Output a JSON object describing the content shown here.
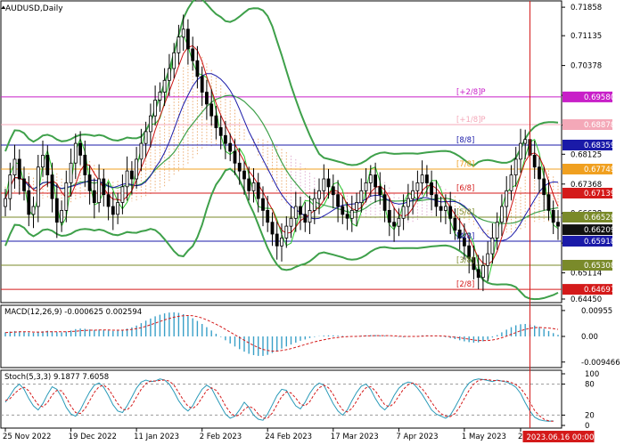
{
  "instrument": {
    "title": "AUDUSD,Daily"
  },
  "chart_data": [
    {
      "type": "candlestick",
      "title": "AUDUSD,Daily",
      "ylim": [
        0.6445,
        0.7195
      ],
      "y_ticks": [
        "0.71858",
        "0.71135",
        "0.70378",
        "0.69621",
        "0.68864",
        "0.68125",
        "0.67368",
        "0.66628",
        "0.65871",
        "0.65114",
        "0.64450"
      ],
      "x_ticks": [
        "25 Nov 2022",
        "19 Dec 2022",
        "11 Jan 2023",
        "2 Feb 2023",
        "24 Feb 2023",
        "17 Mar 2023",
        "7 Apr 2023",
        "1 May 2023",
        "23 May 2023"
      ],
      "crosshair_label": "2023.06.16 00:00",
      "close": [
        0.67,
        0.676,
        0.68,
        0.675,
        0.672,
        0.666,
        0.668,
        0.678,
        0.681,
        0.676,
        0.67,
        0.664,
        0.667,
        0.674,
        0.679,
        0.684,
        0.681,
        0.676,
        0.672,
        0.669,
        0.675,
        0.671,
        0.668,
        0.666,
        0.669,
        0.673,
        0.677,
        0.675,
        0.68,
        0.684,
        0.687,
        0.691,
        0.695,
        0.697,
        0.7,
        0.703,
        0.707,
        0.711,
        0.713,
        0.708,
        0.705,
        0.701,
        0.697,
        0.694,
        0.691,
        0.688,
        0.686,
        0.684,
        0.682,
        0.679,
        0.677,
        0.675,
        0.672,
        0.674,
        0.67,
        0.667,
        0.664,
        0.661,
        0.658,
        0.66,
        0.663,
        0.665,
        0.668,
        0.666,
        0.664,
        0.667,
        0.67,
        0.672,
        0.675,
        0.673,
        0.671,
        0.668,
        0.666,
        0.665,
        0.667,
        0.669,
        0.672,
        0.674,
        0.676,
        0.673,
        0.671,
        0.667,
        0.664,
        0.663,
        0.665,
        0.668,
        0.67,
        0.672,
        0.674,
        0.676,
        0.674,
        0.671,
        0.668,
        0.667,
        0.668,
        0.665,
        0.662,
        0.66,
        0.658,
        0.655,
        0.652,
        0.65,
        0.653,
        0.656,
        0.66,
        0.664,
        0.668,
        0.672,
        0.676,
        0.68,
        0.684,
        0.685,
        0.681,
        0.678,
        0.675,
        0.671,
        0.667,
        0.664,
        0.663
      ],
      "series": [
        {
          "name": "",
          "kind": "bollinger-upper",
          "color": "#3ea04a"
        },
        {
          "name": "",
          "kind": "bollinger-lower",
          "color": "#3ea04a"
        },
        {
          "name": "",
          "kind": "envelope",
          "color": "#27c92a"
        },
        {
          "name": "",
          "kind": "tenkan",
          "color": "#cc1111"
        },
        {
          "name": "",
          "kind": "kijun",
          "color": "#1a1aa8"
        },
        {
          "name": "",
          "kind": "ichimoku-cloud",
          "color": "#e8a05c"
        }
      ],
      "levels": [
        {
          "label": "[+2/8]P",
          "value": "0.69580",
          "color": "#c81fc8"
        },
        {
          "label": "[+1/8]P",
          "value": "0.68878",
          "color": "#f4a8b8"
        },
        {
          "label": "[8/8]",
          "value": "0.68359",
          "color": "#1a1aa8"
        },
        {
          "label": "[7/8]",
          "value": "0.67749",
          "color": "#f0a020"
        },
        {
          "label": "[6/8]",
          "value": "0.67139",
          "color": "#d41a1a"
        },
        {
          "label": "[5/8]",
          "value": "0.66528",
          "color": "#7a8a2a"
        },
        {
          "label": "[4/8]",
          "value": "0.65918",
          "color": "#1a1aa8"
        },
        {
          "label": "[3/8]",
          "value": "0.65308",
          "color": "#7a8a2a"
        },
        {
          "label": "[2/8]",
          "value": "0.64697",
          "color": "#d41a1a"
        }
      ],
      "current_price": "0.66209",
      "current_price_color": "#111111"
    },
    {
      "type": "histogram",
      "title": "MACD(12,26,9) -0.000625 0.002594",
      "ylim": [
        -0.0105,
        0.0105
      ],
      "y_ticks": [
        "0.00955",
        "0.00",
        "-0.009466"
      ],
      "macd": [
        0.0015,
        0.0018,
        0.002,
        0.0019,
        0.0017,
        0.0014,
        0.0013,
        0.0016,
        0.0019,
        0.0021,
        0.0019,
        0.0016,
        0.0015,
        0.0018,
        0.0022,
        0.0027,
        0.0029,
        0.0028,
        0.0026,
        0.0024,
        0.0025,
        0.0024,
        0.0022,
        0.002,
        0.0021,
        0.0024,
        0.0029,
        0.0033,
        0.004,
        0.0049,
        0.0058,
        0.0066,
        0.0074,
        0.008,
        0.0085,
        0.0088,
        0.0089,
        0.0087,
        0.0082,
        0.0075,
        0.0067,
        0.0057,
        0.0046,
        0.0034,
        0.0022,
        0.001,
        -0.0002,
        -0.0014,
        -0.0026,
        -0.0037,
        -0.0047,
        -0.0056,
        -0.0064,
        -0.0069,
        -0.0072,
        -0.0072,
        -0.0068,
        -0.0061,
        -0.0053,
        -0.0045,
        -0.0037,
        -0.003,
        -0.0023,
        -0.0016,
        -0.0011,
        -0.0006,
        -0.0002,
        0.0001,
        0.0003,
        0.0004,
        0.0004,
        0.0003,
        0.0002,
        0.0001,
        0.0001,
        0.0002,
        0.0003,
        0.0004,
        0.0005,
        0.0005,
        0.0004,
        0.0003,
        0.0001,
        -0.0001,
        -0.0002,
        -0.0003,
        -0.0002,
        0.0,
        0.0002,
        0.0004,
        0.0004,
        0.0003,
        0.0001,
        -0.0001,
        -0.0003,
        -0.0006,
        -0.001,
        -0.0014,
        -0.0018,
        -0.0021,
        -0.0023,
        -0.0022,
        -0.0018,
        -0.0012,
        -0.0004,
        0.0005,
        0.0015,
        0.0025,
        0.0034,
        0.0041,
        0.0045,
        0.0046,
        0.0044,
        0.004,
        0.0035,
        0.0028,
        0.002,
        0.0012,
        0.0006
      ],
      "signal": [
        0.0014,
        0.0015,
        0.0016,
        0.0017,
        0.0017,
        0.0017,
        0.0016,
        0.0016,
        0.0016,
        0.0017,
        0.0017,
        0.0017,
        0.0017,
        0.0017,
        0.0018,
        0.0019,
        0.0021,
        0.0022,
        0.0023,
        0.0023,
        0.0024,
        0.0024,
        0.0024,
        0.0023,
        0.0023,
        0.0023,
        0.0024,
        0.0026,
        0.0029,
        0.0032,
        0.0037,
        0.0043,
        0.0049,
        0.0055,
        0.0061,
        0.0066,
        0.0071,
        0.0074,
        0.0076,
        0.0077,
        0.0076,
        0.0073,
        0.0068,
        0.0061,
        0.0053,
        0.0045,
        0.0036,
        0.0026,
        0.0016,
        0.0006,
        -0.0004,
        -0.0014,
        -0.0024,
        -0.0033,
        -0.0041,
        -0.0048,
        -0.0052,
        -0.0054,
        -0.0054,
        -0.0052,
        -0.0049,
        -0.0045,
        -0.004,
        -0.0035,
        -0.003,
        -0.0025,
        -0.002,
        -0.0016,
        -0.0012,
        -0.0009,
        -0.0006,
        -0.0004,
        -0.0002,
        -0.0001,
        0.0,
        0.0,
        0.0001,
        0.0002,
        0.0002,
        0.0003,
        0.0003,
        0.0003,
        0.0003,
        0.0002,
        0.0001,
        0.0,
        0.0,
        0.0,
        0.0,
        0.0001,
        0.0002,
        0.0002,
        0.0002,
        0.0002,
        0.0001,
        -0.0001,
        -0.0003,
        -0.0005,
        -0.0008,
        -0.001,
        -0.0013,
        -0.0015,
        -0.0015,
        -0.0015,
        -0.0013,
        -0.001,
        -0.0005,
        0.0001,
        0.0008,
        0.0014,
        0.0021,
        0.0026,
        0.003,
        0.0032,
        0.0033,
        0.0032,
        0.0031,
        0.0029,
        0.0026
      ]
    },
    {
      "type": "line",
      "title": "Stoch(5,3,3) 9.1877 7.6058",
      "ylim": [
        0,
        100
      ],
      "y_ticks": [
        "100",
        "80",
        "20",
        "0"
      ],
      "main": [
        45,
        58,
        72,
        80,
        70,
        52,
        38,
        30,
        42,
        60,
        75,
        70,
        55,
        35,
        22,
        18,
        30,
        48,
        65,
        78,
        82,
        74,
        58,
        40,
        28,
        25,
        38,
        55,
        72,
        84,
        88,
        85,
        86,
        90,
        88,
        80,
        65,
        48,
        35,
        28,
        38,
        55,
        70,
        78,
        72,
        55,
        38,
        22,
        14,
        18,
        30,
        45,
        35,
        20,
        12,
        10,
        22,
        40,
        58,
        70,
        68,
        52,
        38,
        32,
        45,
        62,
        75,
        82,
        78,
        60,
        42,
        28,
        20,
        30,
        48,
        64,
        76,
        80,
        70,
        52,
        38,
        30,
        40,
        58,
        72,
        80,
        84,
        82,
        72,
        60,
        45,
        30,
        22,
        18,
        14,
        20,
        35,
        52,
        70,
        82,
        88,
        90,
        89,
        87,
        85,
        88,
        86,
        84,
        80,
        74,
        62,
        44,
        28,
        16,
        11,
        9,
        8,
        9
      ],
      "signal": [
        48,
        52,
        62,
        70,
        74,
        67,
        53,
        40,
        36,
        44,
        59,
        68,
        67,
        54,
        37,
        25,
        23,
        32,
        48,
        64,
        75,
        78,
        71,
        57,
        42,
        31,
        30,
        39,
        55,
        70,
        81,
        86,
        86,
        87,
        88,
        86,
        78,
        64,
        49,
        37,
        33,
        40,
        54,
        68,
        73,
        68,
        55,
        38,
        25,
        18,
        20,
        31,
        37,
        33,
        22,
        14,
        14,
        24,
        40,
        56,
        65,
        63,
        53,
        41,
        38,
        46,
        61,
        73,
        78,
        73,
        60,
        43,
        30,
        26,
        33,
        47,
        63,
        73,
        75,
        67,
        53,
        40,
        36,
        43,
        57,
        70,
        79,
        82,
        79,
        71,
        59,
        45,
        32,
        23,
        18,
        17,
        23,
        36,
        52,
        68,
        80,
        87,
        89,
        89,
        87,
        87,
        86,
        86,
        83,
        79,
        72,
        60,
        45,
        29,
        19,
        12,
        9,
        8
      ]
    }
  ],
  "crosshair": {
    "label": "2023.06.16 00:00",
    "color": "#d41a1a"
  }
}
